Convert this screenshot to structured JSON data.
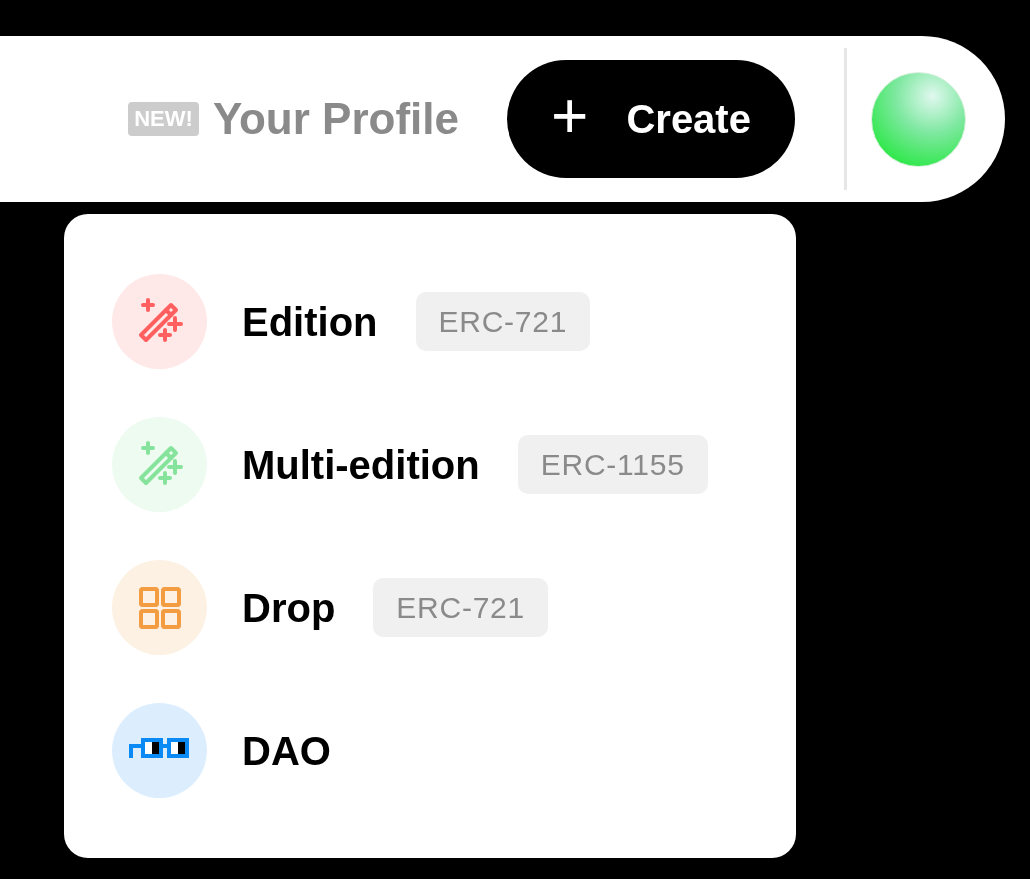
{
  "header": {
    "badge": "NEW!",
    "profile_link": "Your Profile",
    "create_button": {
      "icon": "+",
      "label": "Create"
    }
  },
  "menu": {
    "items": [
      {
        "label": "Edition",
        "tag": "ERC-721",
        "kind": "wand",
        "color": "#ff5f5f"
      },
      {
        "label": "Multi-edition",
        "tag": "ERC-1155",
        "kind": "wand",
        "color": "#86e39b"
      },
      {
        "label": "Drop",
        "tag": "ERC-721",
        "kind": "grid",
        "color": "#f39c42"
      },
      {
        "label": "DAO",
        "kind": "glasses",
        "color": "#0a8af5"
      }
    ]
  }
}
